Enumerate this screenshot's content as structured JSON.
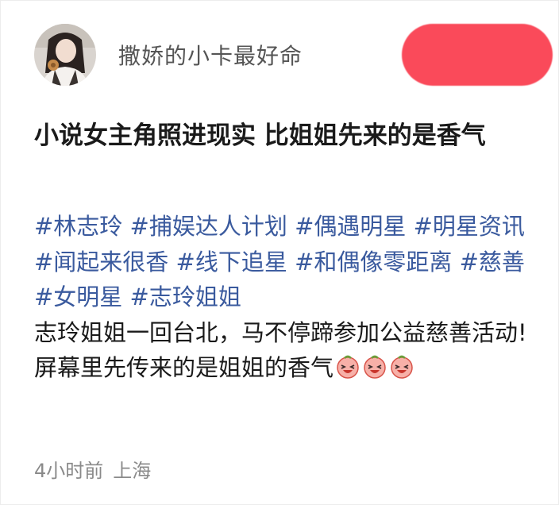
{
  "post": {
    "username": "撒娇的小卡最好命",
    "title": "小说女主角照进现实 比姐姐先来的是香气",
    "hashtags": [
      "#林志玲",
      "#捕娱达人计划",
      "#偶遇明星",
      "#明星资讯",
      "#闻起来很香",
      "#线下追星",
      "#和偶像零距离",
      "#慈善",
      "#女明星",
      "#志玲姐姐"
    ],
    "line1": "志玲姐姐一回台北，马不停蹄参加公益慈善活动!",
    "line2": "屏幕里先传来的是姐姐的香气",
    "emoji_icon": "laughing-face-emoji",
    "emoji_count": 3,
    "time": "4小时前",
    "location": "上海"
  },
  "colors": {
    "hashtag": "#3a5a9e",
    "follow_button": "#fa4a5a",
    "meta": "#8a8a8a"
  }
}
